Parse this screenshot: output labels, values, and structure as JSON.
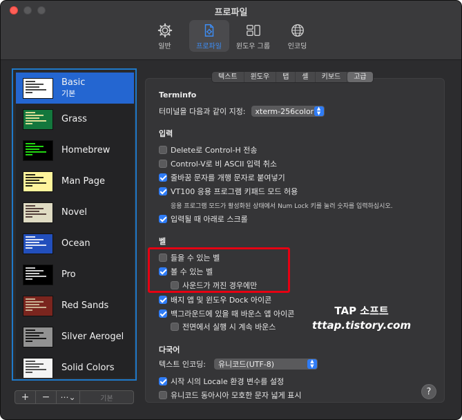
{
  "window": {
    "title": "프로파일"
  },
  "toolbar": {
    "items": [
      {
        "label": "일반",
        "icon": "gear-icon"
      },
      {
        "label": "프로파일",
        "icon": "profile-icon"
      },
      {
        "label": "윈도우 그룹",
        "icon": "window-groups-icon"
      },
      {
        "label": "인코딩",
        "icon": "globe-icon"
      }
    ],
    "active": "프로파일"
  },
  "profiles": [
    {
      "name": "Basic",
      "sub": "기본",
      "selected": true,
      "bg": "#ffffff",
      "fg": "#222222"
    },
    {
      "name": "Grass",
      "bg": "#13773d",
      "fg": "#fff0a5"
    },
    {
      "name": "Homebrew",
      "bg": "#000000",
      "fg": "#28fe14"
    },
    {
      "name": "Man Page",
      "bg": "#fef49c",
      "fg": "#000000"
    },
    {
      "name": "Novel",
      "bg": "#dfdbc3",
      "fg": "#3b2322"
    },
    {
      "name": "Ocean",
      "bg": "#224fbc",
      "fg": "#ffffff"
    },
    {
      "name": "Pro",
      "bg": "#000000",
      "fg": "#f2f2f2"
    },
    {
      "name": "Red Sands",
      "bg": "#7a251e",
      "fg": "#d7c9a7"
    },
    {
      "name": "Silver Aerogel",
      "bg": "#929292",
      "fg": "#000000"
    },
    {
      "name": "Solid Colors",
      "bg": "#f4f4f4",
      "fg": "#333333"
    }
  ],
  "list_controls": {
    "add": "+",
    "remove": "−",
    "more": "⋯⌄",
    "default": "기본"
  },
  "tabs": [
    {
      "label": "텍스트"
    },
    {
      "label": "윈도우"
    },
    {
      "label": "탭"
    },
    {
      "label": "셸"
    },
    {
      "label": "키보드"
    },
    {
      "label": "고급",
      "active": true
    }
  ],
  "advanced": {
    "terminfo_title": "Terminfo",
    "declare_label": "터미널을 다음과 같이 지정:",
    "declare_value": "xterm-256color",
    "input_title": "입력",
    "input_items": [
      {
        "label": "Delete로 Control-H 전송",
        "checked": false
      },
      {
        "label": "Control-V로 비 ASCII 입력 취소",
        "checked": false
      },
      {
        "label": "줄바꿈 문자를 개행 문자로 붙여넣기",
        "checked": true
      },
      {
        "label": "VT100 응용 프로그램 키패드 모드 허용",
        "checked": true
      }
    ],
    "keypad_note": "응용 프로그램 모드가 활성화된 상태에서 Num Lock 키를 눌러 숫자를 입력하십시오.",
    "scroll_to_bottom": {
      "label": "입력될 때 아래로 스크롤",
      "checked": true
    },
    "bell_title": "벨",
    "audible_bell": {
      "label": "들을 수 있는 벨",
      "checked": false
    },
    "visual_bell": {
      "label": "볼 수 있는 벨",
      "checked": true
    },
    "only_when_muted": {
      "label": "사운드가 꺼진 경우에만",
      "checked": false
    },
    "badge_dock": {
      "label": "배지 앱 및 윈도우 Dock 아이콘",
      "checked": true
    },
    "bounce_background": {
      "label": "백그라운드에 있을 때 바운스 앱 아이콘",
      "checked": true
    },
    "bounce_foreground": {
      "label": "전면에서 실행 시 계속 바운스",
      "checked": false
    },
    "intl_title": "다국어",
    "encoding_label": "텍스트 인코딩:",
    "encoding_value": "유니코드(UTF-8)",
    "set_locale": {
      "label": "시작 시의 Locale 환경 변수를 설정",
      "checked": true
    },
    "east_asian": {
      "label": "유니코드 동아시아 모호한 문자 넓게 표시",
      "checked": false
    }
  },
  "help": "?",
  "watermark": {
    "line1": "TAP 소프트",
    "line2": "tttap.tistory.com"
  },
  "colors": {
    "accent": "#2f7cf6",
    "selection": "#2466d1",
    "highlight_box": "#e60012"
  }
}
